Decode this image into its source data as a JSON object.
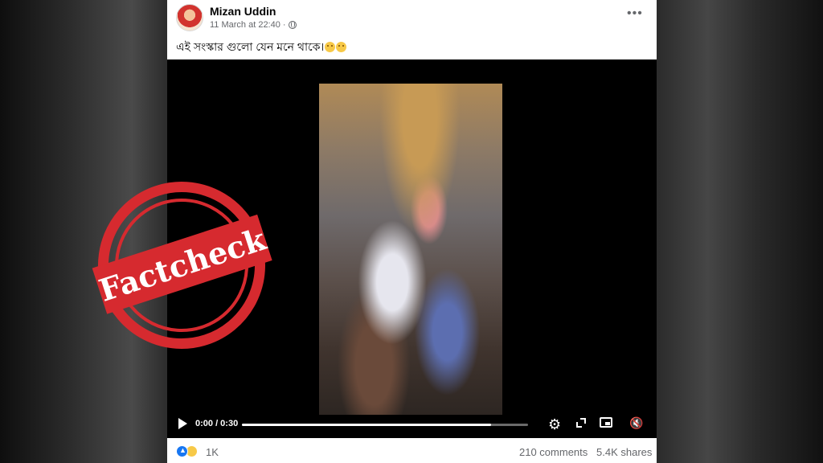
{
  "post": {
    "author": "Mizan Uddin",
    "timestamp": "11 March at 22:40",
    "separator": "·",
    "caption": "এই সংস্কার গুলো যেন মনে থাকে।",
    "more_label": "•••"
  },
  "video": {
    "time": "0:00 / 0:30",
    "progress_fraction": 0.87
  },
  "footer": {
    "reaction_count": "1K",
    "comments": "210 comments",
    "shares": "5.4K shares"
  },
  "stamp": {
    "text": "Factcheck",
    "color": "#d62a2f"
  },
  "colors": {
    "brand": "#1877f2",
    "secondary_text": "#65676b"
  }
}
